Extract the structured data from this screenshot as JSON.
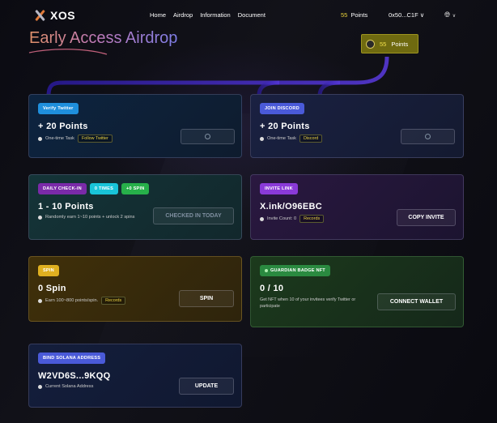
{
  "header": {
    "logo_text": "XOS",
    "nav": [
      "Home",
      "Airdrop",
      "Information",
      "Document"
    ],
    "points_value": "55",
    "points_label": "Points",
    "wallet": "0x50...C1F",
    "wallet_chevron": "chevron-down-icon",
    "language_icon": "globe-icon",
    "language_chevron": "chevron-down-icon"
  },
  "page": {
    "title": "Early Access Airdrop"
  },
  "points_badge": {
    "value": "55",
    "label": "Points"
  },
  "cards": {
    "twitter": {
      "tag": "Verify Twitter",
      "value": "+ 20 Points",
      "sub": "One-time Task",
      "link": "Follow Twitter",
      "button_icon": "lock-icon"
    },
    "discord": {
      "tag": "JOIN DISCORD",
      "value": "+ 20 Points",
      "sub": "One-time Task",
      "link": "Discord",
      "button_icon": "lock-icon"
    },
    "checkin": {
      "tags": [
        "DAILY CHECK-IN",
        "0 TIMES",
        "+0 SPIN"
      ],
      "value": "1 - 10 Points",
      "sub": "Randomly earn 1~10 points + unlock 2 spins",
      "button": "CHECKED IN TODAY"
    },
    "invite": {
      "tag": "INVITE LINK",
      "value": "X.ink/O96EBC",
      "sub": "Invite Count: 0",
      "link": "Records",
      "button": "COPY INVITE"
    },
    "spin": {
      "tag": "SPIN",
      "value": "0 Spin",
      "sub": "Earn 100~800 points/spin.",
      "link": "Records",
      "button": "SPIN"
    },
    "guardian": {
      "tag": "GUARDIAN BADGE NFT",
      "value": "0 / 10",
      "desc": "Get NFT when 10 of your invitees verify Twitter or participate",
      "button": "CONNECT WALLET"
    },
    "solana": {
      "tag": "BIND SOLANA ADDRESS",
      "value": "W2VD6S...9KQQ",
      "sub": "Current Solana Address",
      "button": "UPDATE"
    }
  },
  "colors": {
    "background": "#07070b",
    "points_yellow": "#e8d23a",
    "badge_bg": "#6f6a10",
    "connector": "#3a2ad8"
  }
}
